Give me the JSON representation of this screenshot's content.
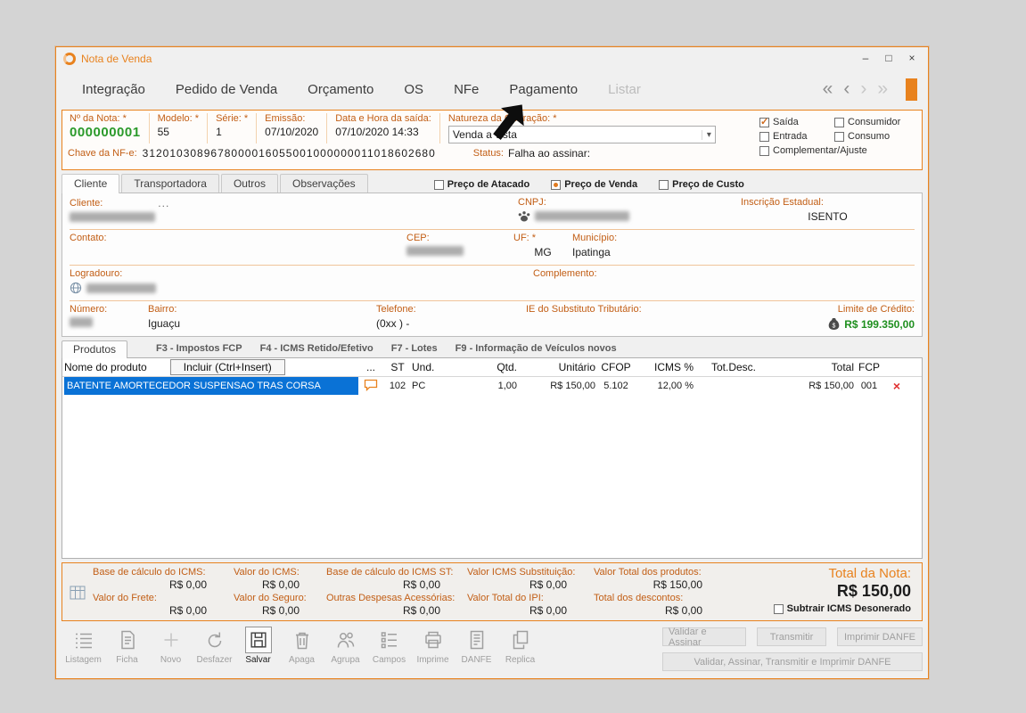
{
  "window": {
    "title": "Nota de Venda",
    "icons": {
      "minimize": "–",
      "maximize": "□",
      "close": "×"
    }
  },
  "menu": {
    "items": [
      {
        "label": "Integração",
        "disabled": false
      },
      {
        "label": "Pedido de Venda",
        "disabled": false
      },
      {
        "label": "Orçamento",
        "disabled": false
      },
      {
        "label": "OS",
        "disabled": false
      },
      {
        "label": "NFe",
        "disabled": false
      },
      {
        "label": "Pagamento",
        "disabled": false
      },
      {
        "label": "Listar",
        "disabled": true
      }
    ],
    "nav": [
      "«",
      "‹",
      "›",
      "»"
    ]
  },
  "header": {
    "nota": {
      "label": "Nº da Nota: *",
      "value": "000000001"
    },
    "modelo": {
      "label": "Modelo: *",
      "value": "55"
    },
    "serie": {
      "label": "Série: *",
      "value": "1"
    },
    "emissao": {
      "label": "Emissão:",
      "value": "07/10/2020"
    },
    "saida": {
      "label": "Data e Hora da saída:",
      "value": "07/10/2020 14:33"
    },
    "natureza": {
      "label": "Natureza da Operação: *",
      "value": "Venda a vista",
      "dropdown": "▾"
    },
    "chave": {
      "label": "Chave da NF-e:",
      "value": "3120103089678000016055001000000011018602680"
    },
    "status": {
      "label": "Status:",
      "value": "Falha ao assinar:"
    },
    "checkboxes": [
      {
        "label": "Saída",
        "checked": true
      },
      {
        "label": "Consumidor",
        "checked": false
      },
      {
        "label": "Entrada",
        "checked": false
      },
      {
        "label": "Consumo",
        "checked": false
      },
      {
        "label": "Complementar/Ajuste",
        "checked": false
      }
    ]
  },
  "tabs": [
    {
      "label": "Cliente",
      "active": true
    },
    {
      "label": "Transportadora",
      "active": false
    },
    {
      "label": "Outros",
      "active": false
    },
    {
      "label": "Observações",
      "active": false
    }
  ],
  "price_radios": [
    {
      "label": "Preço de Atacado",
      "selected": false
    },
    {
      "label": "Preço de Venda",
      "selected": true
    },
    {
      "label": "Preço de Custo",
      "selected": false
    }
  ],
  "client": {
    "cliente_label": "Cliente:",
    "cliente_more": "...",
    "cnpj_label": "CNPJ:",
    "ie_label": "Inscrição Estadual:",
    "ie_value": "ISENTO",
    "contato_label": "Contato:",
    "cep_label": "CEP:",
    "uf_label": "UF: *",
    "uf_value": "MG",
    "municipio_label": "Município:",
    "municipio_value": "Ipatinga",
    "logradouro_label": "Logradouro:",
    "complemento_label": "Complemento:",
    "numero_label": "Número:",
    "bairro_label": "Bairro:",
    "bairro_value": "Iguaçu",
    "telefone_label": "Telefone:",
    "telefone_value": "(0xx )  -",
    "ie_subst_label": "IE do Substituto Tributário:",
    "limite_label": "Limite de Crédito:",
    "limite_value": "R$ 199.350,00"
  },
  "products": {
    "tab": "Produtos",
    "hotkeys": [
      "F3 - Impostos FCP",
      "F4 - ICMS Retido/Efetivo",
      "F7 - Lotes",
      "F9 - Informação de Veículos novos"
    ],
    "incluir_button": "Incluir (Ctrl+Insert)",
    "columns": [
      "Nome do produto",
      "...",
      "ST",
      "Und.",
      "Qtd.",
      "Unitário",
      "CFOP",
      "ICMS %",
      "Tot.Desc.",
      "Total",
      "FCP"
    ],
    "delete_glyph": "×",
    "rows": [
      {
        "nome": "BATENTE AMORTECEDOR SUSPENSAO TRAS CORSA",
        "st": "102",
        "und": "PC",
        "qtd": "1,00",
        "unitario": "R$ 150,00",
        "cfop": "5.102",
        "icms": "12,00 %",
        "tot_desc": "",
        "total": "R$ 150,00",
        "fcp": "001"
      }
    ]
  },
  "totals": {
    "base_icms": {
      "label": "Base de cálculo do ICMS:",
      "value": "R$ 0,00"
    },
    "valor_icms": {
      "label": "Valor do ICMS:",
      "value": "R$ 0,00"
    },
    "base_icms_st": {
      "label": "Base de cálculo do ICMS ST:",
      "value": "R$ 0,00"
    },
    "valor_icms_sub": {
      "label": "Valor ICMS Substituição:",
      "value": "R$ 0,00"
    },
    "total_produtos": {
      "label": "Valor Total dos produtos:",
      "value": "R$ 150,00"
    },
    "frete": {
      "label": "Valor do Frete:",
      "value": "R$ 0,00"
    },
    "seguro": {
      "label": "Valor do Seguro:",
      "value": "R$ 0,00"
    },
    "despesas": {
      "label": "Outras Despesas Acessórias:",
      "value": "R$ 0,00"
    },
    "ipi": {
      "label": "Valor Total do IPI:",
      "value": "R$ 0,00"
    },
    "descontos": {
      "label": "Total dos descontos:",
      "value": "R$ 0,00"
    },
    "total_nota": {
      "label": "Total da Nota:",
      "value": "R$ 150,00"
    },
    "subtrair": {
      "label": "Subtrair ICMS Desonerado",
      "checked": false
    }
  },
  "toolbar": {
    "items": [
      "Listagem",
      "Ficha",
      "Novo",
      "Desfazer",
      "Salvar",
      "Apaga",
      "Agrupa",
      "Campos",
      "Imprime",
      "DANFE",
      "Replica"
    ],
    "buttons": [
      "Validar e Assinar",
      "Transmitir",
      "Imprimir DANFE",
      "Validar, Assinar, Transmitir e Imprimir DANFE"
    ]
  }
}
